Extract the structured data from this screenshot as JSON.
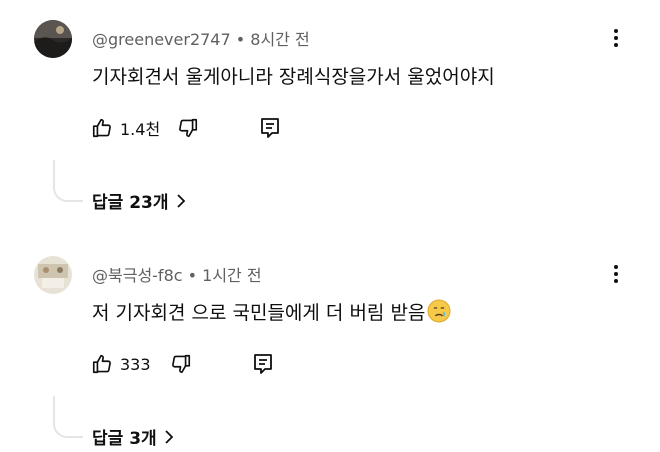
{
  "comments": [
    {
      "author": "@greenever2747",
      "time": "8시간 전",
      "text": "기자회견서 울게아니라 장례식장을가서 울었어야지",
      "likes": "1.4천",
      "replies": "답글 23개",
      "avatar_icon": "profile-photo"
    },
    {
      "author": "@북극성-f8c",
      "time": "1시간 전",
      "text": "저 기자회견 으로 국민들에게 더 버림 받음",
      "emoji": "crying-face-emoji",
      "likes": "333",
      "replies": "답글 3개",
      "avatar_icon": "profile-photo"
    }
  ],
  "separator": " • ",
  "icons": {
    "like": "thumbs-up-icon",
    "dislike": "thumbs-down-icon",
    "reply": "reply-comment-icon",
    "menu": "more-vert-icon",
    "chevron": "chevron-right-icon"
  }
}
